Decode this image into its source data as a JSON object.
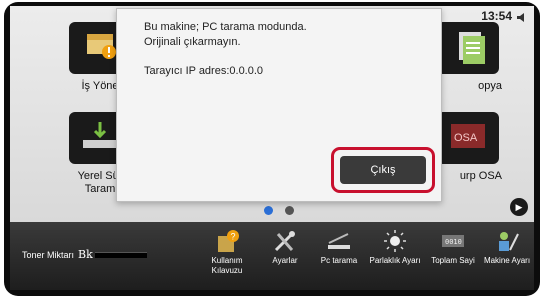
{
  "status": {
    "clock": "13:54"
  },
  "apps": [
    {
      "label": "İş Yöne"
    },
    {
      "label": "Yerel Sür\nTaram"
    },
    {
      "label": "opya"
    },
    {
      "label": "urp OSA"
    }
  ],
  "dialog": {
    "message_line1": "Bu makine; PC tarama modunda.",
    "message_line2": "Orijinali çıkarmayın.",
    "ip_text": "Tarayıcı IP adres:0.0.0.0",
    "exit_label": "Çıkış"
  },
  "bottombar": {
    "toner_label": "Toner Miktarı",
    "toner_color": "Bk",
    "tools": [
      {
        "label": "Kullanım Kılavuzu",
        "icon": "manual-icon"
      },
      {
        "label": "Ayarlar",
        "icon": "tools-icon"
      },
      {
        "label": "Pc tarama",
        "icon": "scanner-icon"
      },
      {
        "label": "Parlaklık Ayarı",
        "icon": "brightness-icon"
      },
      {
        "label": "Toplam Sayi",
        "icon": "counter-icon"
      },
      {
        "label": "Makine Ayarı",
        "icon": "machine-settings-icon"
      }
    ]
  },
  "colors": {
    "accent": "#2b6fd6",
    "highlight": "#c8102e"
  }
}
